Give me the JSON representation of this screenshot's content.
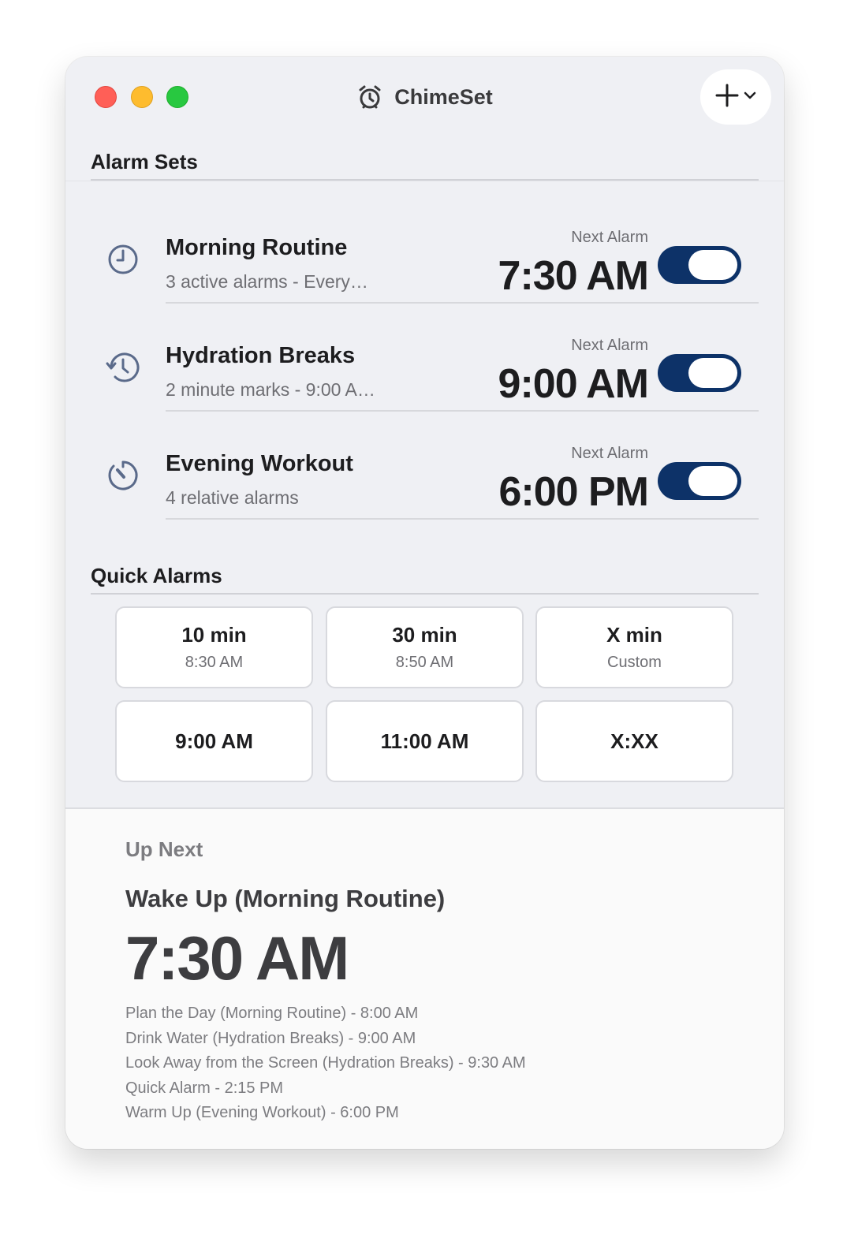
{
  "window": {
    "title": "ChimeSet"
  },
  "sections": {
    "alarm_sets": "Alarm Sets",
    "quick_alarms": "Quick Alarms"
  },
  "alarm_sets": [
    {
      "name": "Morning Routine",
      "subtitle": "3 active alarms - Every…",
      "next_label": "Next Alarm",
      "time": "7:30 AM",
      "enabled": true,
      "icon": "clock-icon"
    },
    {
      "name": "Hydration Breaks",
      "subtitle": "2 minute marks - 9:00 A…",
      "next_label": "Next Alarm",
      "time": "9:00 AM",
      "enabled": true,
      "icon": "history-icon"
    },
    {
      "name": "Evening Workout",
      "subtitle": "4 relative alarms",
      "next_label": "Next Alarm",
      "time": "6:00 PM",
      "enabled": true,
      "icon": "timer-icon"
    }
  ],
  "quick_alarms": [
    {
      "label": "10 min",
      "sub": "8:30 AM"
    },
    {
      "label": "30 min",
      "sub": "8:50 AM"
    },
    {
      "label": "X min",
      "sub": "Custom"
    },
    {
      "label": "9:00 AM",
      "sub": ""
    },
    {
      "label": "11:00 AM",
      "sub": ""
    },
    {
      "label": "X:XX",
      "sub": ""
    }
  ],
  "up_next": {
    "label": "Up Next",
    "title": "Wake Up (Morning Routine)",
    "time": "7:30 AM",
    "upcoming": [
      "Plan the Day (Morning Routine) - 8:00 AM",
      "Drink Water (Hydration Breaks) - 9:00 AM",
      "Look Away from the Screen (Hydration Breaks) - 9:30 AM",
      "Quick Alarm - 2:15 PM",
      "Warm Up (Evening Workout) - 6:00 PM"
    ]
  },
  "colors": {
    "toggle_on": "#0d3268",
    "accent_icon": "#5a6a8a",
    "window_bg": "#eff0f4"
  }
}
